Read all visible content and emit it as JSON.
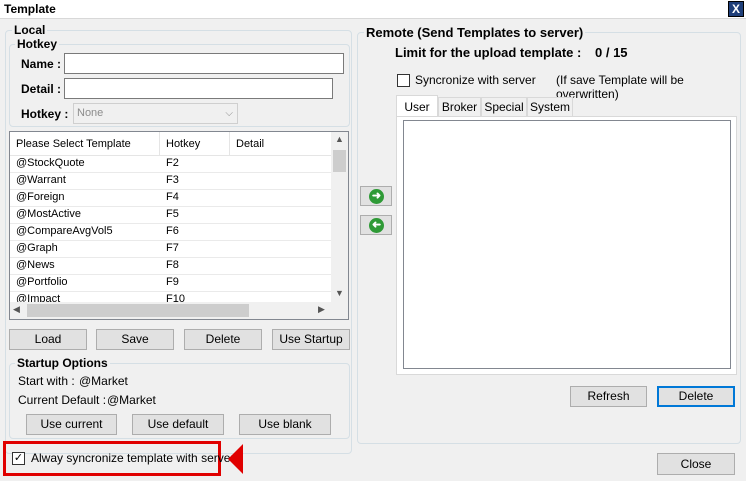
{
  "window": {
    "title": "Template",
    "close_glyph": "X"
  },
  "local": {
    "group_title": "Local",
    "hotkey_group_title": "Hotkey",
    "name_label": "Name :",
    "name_value": "",
    "detail_label": "Detail :",
    "detail_value": "",
    "hotkey_label": "Hotkey :",
    "hotkey_value": "None",
    "table": {
      "columns": [
        "Please Select Template",
        "Hotkey",
        "Detail"
      ],
      "rows": [
        {
          "template": "@StockQuote",
          "hotkey": "F2",
          "detail": ""
        },
        {
          "template": "@Warrant",
          "hotkey": "F3",
          "detail": ""
        },
        {
          "template": "@Foreign",
          "hotkey": "F4",
          "detail": ""
        },
        {
          "template": "@MostActive",
          "hotkey": "F5",
          "detail": ""
        },
        {
          "template": "@CompareAvgVol5",
          "hotkey": "F6",
          "detail": ""
        },
        {
          "template": "@Graph",
          "hotkey": "F7",
          "detail": ""
        },
        {
          "template": "@News",
          "hotkey": "F8",
          "detail": ""
        },
        {
          "template": "@Portfolio",
          "hotkey": "F9",
          "detail": ""
        },
        {
          "template": "@Impact",
          "hotkey": "F10",
          "detail": ""
        }
      ]
    },
    "buttons": {
      "load": "Load",
      "save": "Save",
      "delete": "Delete",
      "use_startup": "Use Startup"
    },
    "startup": {
      "group_title": "Startup Options",
      "start_with_label": "Start with :",
      "start_with_value": "@Market",
      "current_default_label": "Current Default :",
      "current_default_value": "@Market",
      "use_current": "Use current",
      "use_default": "Use default",
      "use_blank": "Use blank"
    },
    "always_sync": {
      "label": "Alway syncronize template with server",
      "checked": true
    }
  },
  "transfer": {
    "to_remote_icon": "arrow-right-icon",
    "to_local_icon": "arrow-left-icon"
  },
  "remote": {
    "group_title": "Remote (Send Templates to server)",
    "limit_label": "Limit for the upload template :",
    "limit_value": "0 / 15",
    "sync_label": "Syncronize with server",
    "sync_note": "(If save Template will be overwritten)",
    "sync_checked": false,
    "tabs": [
      "User",
      "Broker",
      "Special",
      "System"
    ],
    "active_tab": "User",
    "refresh": "Refresh",
    "delete": "Delete"
  },
  "footer": {
    "close": "Close"
  },
  "colors": {
    "highlight": "#e00000",
    "arrow_green": "#2e9a36",
    "focus_blue": "#0078d7"
  }
}
